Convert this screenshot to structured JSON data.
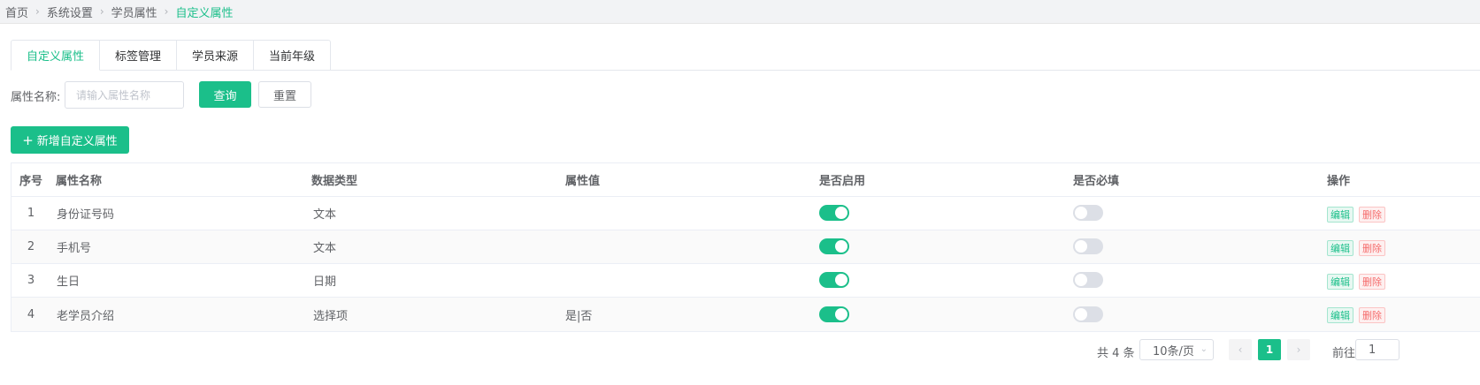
{
  "breadcrumb": [
    "首页",
    "系统设置",
    "学员属性",
    "自定义属性"
  ],
  "tabs": [
    {
      "label": "自定义属性",
      "active": true
    },
    {
      "label": "标签管理",
      "active": false
    },
    {
      "label": "学员来源",
      "active": false
    },
    {
      "label": "当前年级",
      "active": false
    }
  ],
  "filter": {
    "label": "属性名称:",
    "placeholder": "请输入属性名称",
    "query_label": "查询",
    "reset_label": "重置"
  },
  "add_button_label": "新增自定义属性",
  "table": {
    "columns": [
      "序号",
      "属性名称",
      "数据类型",
      "属性值",
      "是否启用",
      "是否必填",
      "操作"
    ],
    "rows": [
      {
        "index": "1",
        "name": "身份证号码",
        "type": "文本",
        "value": "",
        "enabled": true,
        "required": false
      },
      {
        "index": "2",
        "name": "手机号",
        "type": "文本",
        "value": "",
        "enabled": true,
        "required": false
      },
      {
        "index": "3",
        "name": "生日",
        "type": "日期",
        "value": "",
        "enabled": true,
        "required": false
      },
      {
        "index": "4",
        "name": "老学员介绍",
        "type": "选择项",
        "value": "是|否",
        "enabled": true,
        "required": false
      }
    ],
    "actions": {
      "edit": "编辑",
      "delete": "删除"
    }
  },
  "pagination": {
    "total_text": "共 4 条",
    "page_size": "10条/页",
    "current_page": "1",
    "goto_label": "前往",
    "goto_value": "1"
  },
  "colors": {
    "accent": "#1bbf8a",
    "danger": "#f56c6c"
  }
}
